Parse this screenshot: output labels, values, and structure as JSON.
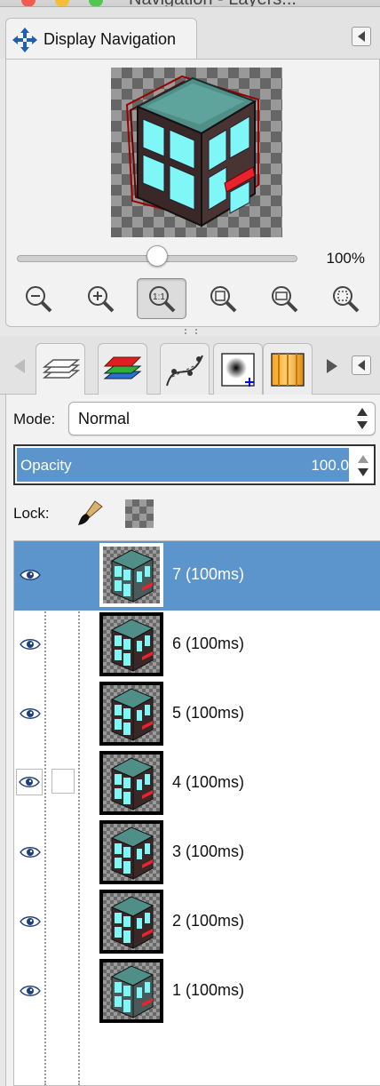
{
  "window": {
    "title": "Navigation - Layers..."
  },
  "navigation": {
    "tab_label": "Display Navigation",
    "zoom_percent": "100%",
    "zoom_slider_value": 0.5,
    "zoom_buttons": [
      {
        "icon": "zoom-out-icon",
        "label": ""
      },
      {
        "icon": "zoom-in-icon",
        "label": ""
      },
      {
        "icon": "zoom-1-1-icon",
        "label": "1:1"
      },
      {
        "icon": "zoom-fit-image-icon",
        "label": ""
      },
      {
        "icon": "zoom-fill-window-icon",
        "label": ""
      },
      {
        "icon": "zoom-shrink-wrap-icon",
        "label": ""
      }
    ]
  },
  "layers": {
    "dock_tabs": [
      {
        "icon": "layers-icon",
        "active": true
      },
      {
        "icon": "channels-icon",
        "active": false
      },
      {
        "icon": "paths-icon",
        "active": false
      },
      {
        "icon": "brushes-icon",
        "active": false
      },
      {
        "icon": "gradients-icon",
        "active": false
      }
    ],
    "mode_label": "Mode:",
    "mode_value": "Normal",
    "opacity_label": "Opacity",
    "opacity_value": "100.0",
    "lock_label": "Lock:",
    "items": [
      {
        "name": "7 (100ms)",
        "selected": true,
        "variant": "light"
      },
      {
        "name": "6 (100ms)",
        "selected": false,
        "variant": "dark"
      },
      {
        "name": "5 (100ms)",
        "selected": false,
        "variant": "dark"
      },
      {
        "name": "4 (100ms)",
        "selected": false,
        "variant": "dark"
      },
      {
        "name": "3 (100ms)",
        "selected": false,
        "variant": "dark"
      },
      {
        "name": "2 (100ms)",
        "selected": false,
        "variant": "dark"
      },
      {
        "name": "1 (100ms)",
        "selected": false,
        "variant": "light"
      }
    ]
  },
  "colors": {
    "selection": "#5b95cb",
    "building_roof": "#4f8f88",
    "building_glass": "#7ff7f7",
    "building_wall": "#3a2727",
    "awning": "#e8232e"
  }
}
